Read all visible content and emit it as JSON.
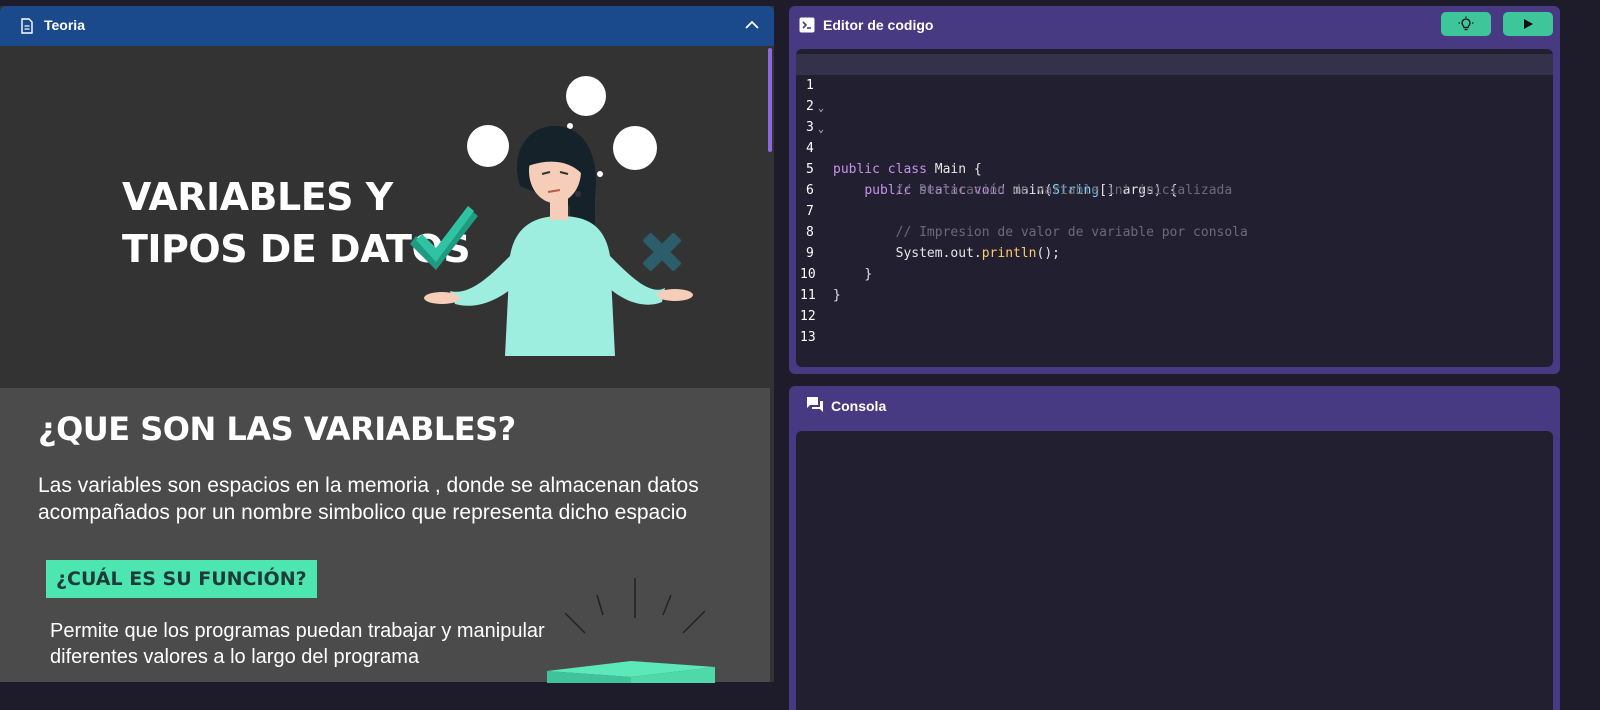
{
  "teoria": {
    "title": "Teoria",
    "slide_title_line1": "VARIABLES Y",
    "slide_title_line2": "TIPOS DE DATOS",
    "question_title": "¿QUE SON LAS VARIABLES?",
    "question_body": "Las variables son espacios en la memoria , donde se almacenan datos acompañados por un nombre simbolico que representa dicho espacio",
    "function_badge": "¿CUÁL ES SU FUNCIÓN?",
    "function_body": "Permite que los programas puedan trabajar y manipular diferentes valores a lo largo del programa"
  },
  "editor": {
    "title": "Editor de codigo",
    "hint_icon": "lightbulb-icon",
    "run_icon": "play-icon",
    "line_numbers": [
      "1",
      "2",
      "3",
      "4",
      "5",
      "6",
      "7",
      "8",
      "9",
      "10",
      "11",
      "12",
      "13"
    ],
    "code": {
      "l3_kw": "public class",
      "l3_rest": " Main {",
      "l4_kw": "public static void",
      "l4_fn": " main(",
      "l4_type": "String",
      "l4_rest": "[] args) {",
      "l5_comment": "// Declaración de variable int inicializada",
      "l7_comment": "// Impresion de valor de variable por consola",
      "l8_obj": "System.out.",
      "l8_fn": "println",
      "l8_rest": "();",
      "l9": "}",
      "l10": "}"
    }
  },
  "console": {
    "title": "Consola"
  },
  "colors": {
    "teoria_header": "#1b4a8c",
    "panel_purple": "#473a82",
    "code_bg": "#211f30",
    "accent_green": "#3fc59a",
    "badge_green": "#4ee6b0"
  }
}
